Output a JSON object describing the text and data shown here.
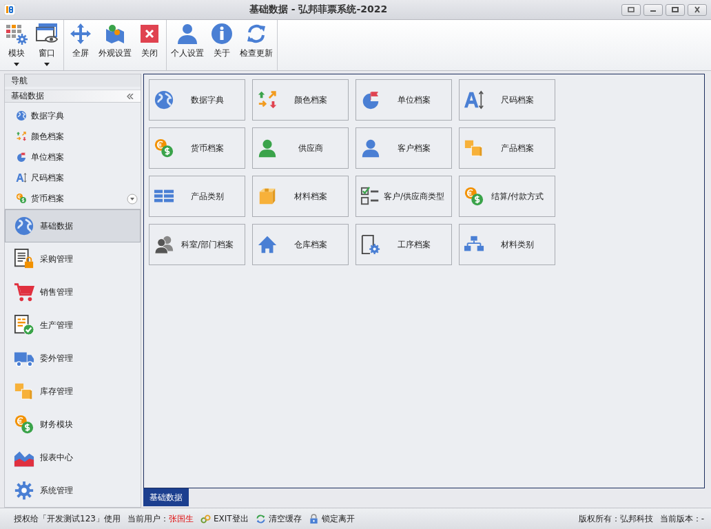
{
  "window": {
    "title": "基础数据 - 弘邦菲票系统-2022"
  },
  "toolbar": {
    "groups": [
      [
        {
          "label": "模块",
          "dropdown": true
        },
        {
          "label": "窗口",
          "dropdown": true
        }
      ],
      [
        {
          "label": "全屏",
          "dropdown": false
        },
        {
          "label": "外观设置",
          "dropdown": false
        },
        {
          "label": "关闭",
          "dropdown": false
        }
      ],
      [
        {
          "label": "个人设置",
          "dropdown": false
        },
        {
          "label": "关于",
          "dropdown": false
        },
        {
          "label": "检查更新",
          "dropdown": false
        }
      ]
    ]
  },
  "sidebar": {
    "header": "导航",
    "group": {
      "title": "基础数据",
      "expanded": true
    },
    "items": [
      {
        "label": "数据字典"
      },
      {
        "label": "颜色档案"
      },
      {
        "label": "单位档案"
      },
      {
        "label": "尺码档案"
      },
      {
        "label": "货币档案"
      }
    ],
    "modules": [
      {
        "label": "基础数据",
        "selected": true
      },
      {
        "label": "采购管理",
        "selected": false
      },
      {
        "label": "销售管理",
        "selected": false
      },
      {
        "label": "生产管理",
        "selected": false
      },
      {
        "label": "委外管理",
        "selected": false
      },
      {
        "label": "库存管理",
        "selected": false
      },
      {
        "label": "财务模块",
        "selected": false
      },
      {
        "label": "报表中心",
        "selected": false
      },
      {
        "label": "系统管理",
        "selected": false
      }
    ]
  },
  "tiles": [
    {
      "label": "数据字典"
    },
    {
      "label": "颜色档案"
    },
    {
      "label": "单位档案"
    },
    {
      "label": "尺码档案"
    },
    {
      "label": "货币档案"
    },
    {
      "label": "供应商"
    },
    {
      "label": "客户档案"
    },
    {
      "label": "产品档案"
    },
    {
      "label": "产品类别"
    },
    {
      "label": "材料档案"
    },
    {
      "label": "客户/供应商类型"
    },
    {
      "label": "结算/付款方式"
    },
    {
      "label": "科室/部门档案"
    },
    {
      "label": "仓库档案"
    },
    {
      "label": "工序档案"
    },
    {
      "label": "材料类别"
    }
  ],
  "document_tabs": [
    {
      "label": "基础数据",
      "selected": true
    }
  ],
  "status_bar": {
    "license": "授权给「开发测试123」使用",
    "user_label": "当前用户：",
    "user": "张国生",
    "actions": [
      {
        "label": "EXIT登出"
      },
      {
        "label": "清空缓存"
      },
      {
        "label": "锁定离开"
      }
    ],
    "copyright": "版权所有：弘邦科技",
    "version": "当前版本：-"
  }
}
